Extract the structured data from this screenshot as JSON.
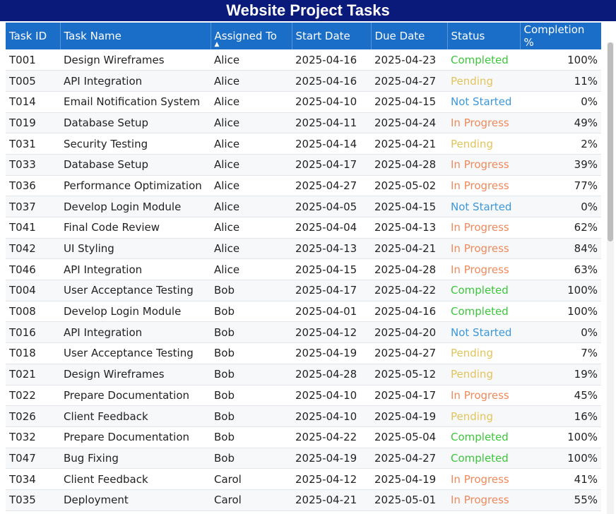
{
  "title": "Website Project Tasks",
  "colors": {
    "title_bg": "#0a1a7a",
    "header_bg": "#1a6ec8",
    "completed": "#3cc63c",
    "pending": "#e3c45a",
    "not_started": "#3c98d8",
    "in_progress": "#ee8a5c"
  },
  "table": {
    "columns": [
      "Task ID",
      "Task Name",
      "Assigned To",
      "Start Date",
      "Due Date",
      "Status",
      "Completion %"
    ],
    "sort_indicator": "▲",
    "rows": [
      [
        "T001",
        "Design Wireframes",
        "Alice",
        "2025-04-16",
        "2025-04-23",
        "Completed",
        "100%"
      ],
      [
        "T005",
        "API Integration",
        "Alice",
        "2025-04-16",
        "2025-04-27",
        "Pending",
        "11%"
      ],
      [
        "T014",
        "Email Notification System",
        "Alice",
        "2025-04-10",
        "2025-04-15",
        "Not Started",
        "0%"
      ],
      [
        "T019",
        "Database Setup",
        "Alice",
        "2025-04-11",
        "2025-04-24",
        "In Progress",
        "49%"
      ],
      [
        "T031",
        "Security Testing",
        "Alice",
        "2025-04-14",
        "2025-04-21",
        "Pending",
        "2%"
      ],
      [
        "T033",
        "Database Setup",
        "Alice",
        "2025-04-17",
        "2025-04-28",
        "In Progress",
        "39%"
      ],
      [
        "T036",
        "Performance Optimization",
        "Alice",
        "2025-04-27",
        "2025-05-02",
        "In Progress",
        "77%"
      ],
      [
        "T037",
        "Develop Login Module",
        "Alice",
        "2025-04-05",
        "2025-04-15",
        "Not Started",
        "0%"
      ],
      [
        "T041",
        "Final Code Review",
        "Alice",
        "2025-04-04",
        "2025-04-13",
        "In Progress",
        "62%"
      ],
      [
        "T042",
        "UI Styling",
        "Alice",
        "2025-04-13",
        "2025-04-21",
        "In Progress",
        "84%"
      ],
      [
        "T046",
        "API Integration",
        "Alice",
        "2025-04-15",
        "2025-04-28",
        "In Progress",
        "63%"
      ],
      [
        "T004",
        "User Acceptance Testing",
        "Bob",
        "2025-04-17",
        "2025-04-22",
        "Completed",
        "100%"
      ],
      [
        "T008",
        "Develop Login Module",
        "Bob",
        "2025-04-01",
        "2025-04-16",
        "Completed",
        "100%"
      ],
      [
        "T016",
        "API Integration",
        "Bob",
        "2025-04-12",
        "2025-04-20",
        "Not Started",
        "0%"
      ],
      [
        "T018",
        "User Acceptance Testing",
        "Bob",
        "2025-04-19",
        "2025-04-27",
        "Pending",
        "7%"
      ],
      [
        "T021",
        "Design Wireframes",
        "Bob",
        "2025-04-28",
        "2025-05-12",
        "Pending",
        "19%"
      ],
      [
        "T022",
        "Prepare Documentation",
        "Bob",
        "2025-04-10",
        "2025-04-17",
        "In Progress",
        "45%"
      ],
      [
        "T026",
        "Client Feedback",
        "Bob",
        "2025-04-10",
        "2025-04-19",
        "Pending",
        "16%"
      ],
      [
        "T032",
        "Prepare Documentation",
        "Bob",
        "2025-04-22",
        "2025-05-04",
        "Completed",
        "100%"
      ],
      [
        "T047",
        "Bug Fixing",
        "Bob",
        "2025-04-19",
        "2025-04-27",
        "Completed",
        "100%"
      ],
      [
        "T034",
        "Client Feedback",
        "Carol",
        "2025-04-12",
        "2025-04-19",
        "In Progress",
        "41%"
      ],
      [
        "T035",
        "Deployment",
        "Carol",
        "2025-04-21",
        "2025-05-01",
        "In Progress",
        "55%"
      ]
    ]
  }
}
